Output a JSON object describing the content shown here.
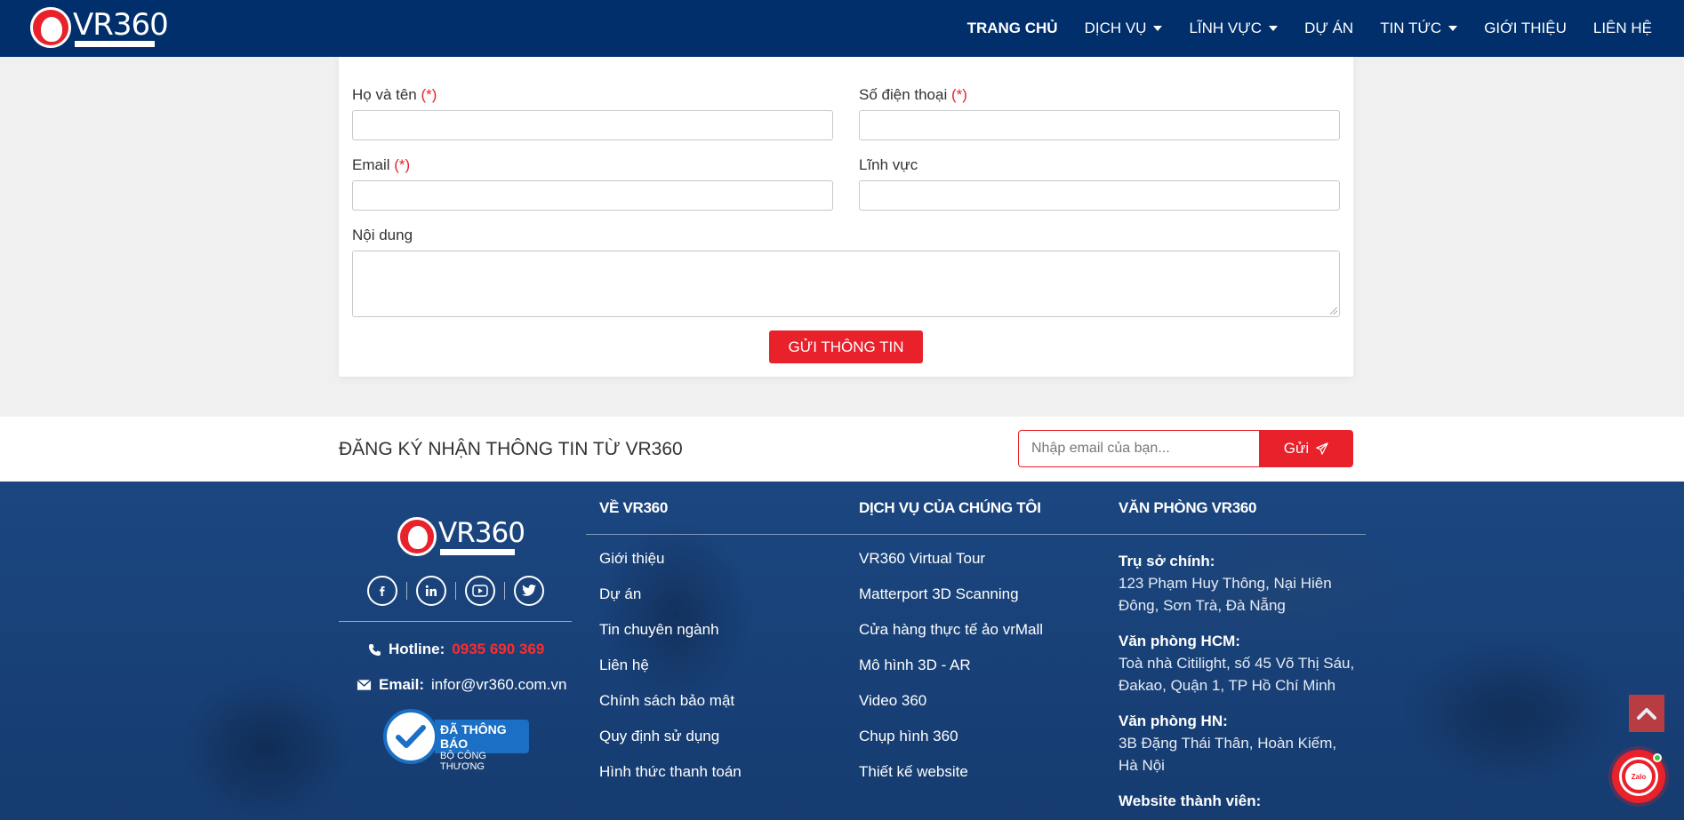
{
  "header": {
    "logo_text": "VR360",
    "nav": [
      {
        "label": "TRANG CHỦ"
      },
      {
        "label": "DỊCH VỤ"
      },
      {
        "label": "LĨNH VỰC"
      },
      {
        "label": "DỰ ÁN"
      },
      {
        "label": "TIN TỨC"
      },
      {
        "label": "GIỚI THIỆU"
      },
      {
        "label": "LIÊN HỆ"
      }
    ]
  },
  "form": {
    "name_label": "Họ và tên",
    "phone_label": "Số điện thoại",
    "email_label": "Email",
    "field_label": "Lĩnh vực",
    "content_label": "Nội dung",
    "required_mark": "(*)",
    "submit_label": "GỬI THÔNG TIN"
  },
  "newsletter": {
    "title": "ĐĂNG KÝ NHẬN THÔNG TIN TỪ VR360",
    "placeholder": "Nhập email của bạn...",
    "button_label": "Gửi"
  },
  "footer": {
    "logo_text": "VR360",
    "hotline_label": "Hotline:",
    "hotline_value": "0935 690 369",
    "email_label": "Email:",
    "email_value": "infor@vr360.com.vn",
    "badge_line1": "ĐÃ THÔNG BÁO",
    "badge_line2": "BỘ CÔNG THƯƠNG",
    "about_title": "VỀ VR360",
    "about_links": [
      "Giới thiệu",
      "Dự án",
      "Tin chuyên ngành",
      "Liên hệ",
      "Chính sách bảo mật",
      "Quy định sử dụng",
      "Hình thức thanh toán"
    ],
    "services_title": "DỊCH VỤ CỦA CHÚNG TÔI",
    "service_links": [
      "VR360 Virtual Tour",
      "Matterport 3D Scanning",
      "Cửa hàng thực tế ảo vrMall",
      "Mô hình 3D - AR",
      "Video 360",
      "Chụp hình 360",
      "Thiết kế website"
    ],
    "office_title": "VĂN PHÒNG VR360",
    "offices": [
      {
        "title": "Trụ sở chính:",
        "address": "123 Phạm Huy Thông, Nại Hiên Đông, Sơn Trà, Đà Nẵng"
      },
      {
        "title": "Văn phòng HCM:",
        "address": "Toà nhà Citilight, số 45 Võ Thị Sáu, Đakao, Quận 1, TP Hồ Chí Minh"
      },
      {
        "title": "Văn phòng HN:",
        "address": "3B Đặng Thái Thân, Hoàn Kiếm, Hà Nội"
      },
      {
        "title": "Website thành viên:",
        "address": ""
      }
    ]
  },
  "widgets": {
    "zalo_label": "Zalo"
  },
  "colors": {
    "primary": "#002f6c",
    "accent": "#e8212b",
    "footer_bg": "#163e74"
  }
}
